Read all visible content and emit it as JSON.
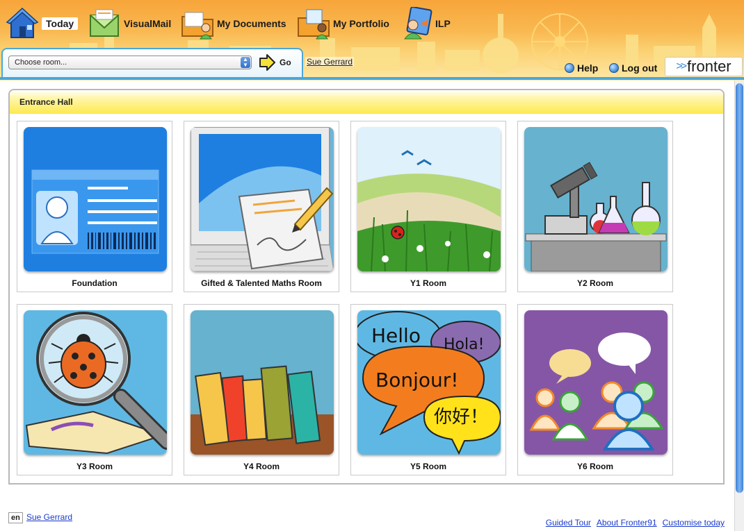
{
  "nav": [
    {
      "label": "Today",
      "icon": "house-icon",
      "active": true
    },
    {
      "label": "VisualMail",
      "icon": "mail-icon"
    },
    {
      "label": "My Documents",
      "icon": "documents-folder-icon"
    },
    {
      "label": "My Portfolio",
      "icon": "portfolio-folder-icon"
    },
    {
      "label": "ILP",
      "icon": "ilp-icon"
    }
  ],
  "room_bar": {
    "select_value": "Choose room...",
    "go_label": "Go",
    "user_name": "Sue Gerrard"
  },
  "utility": {
    "help_label": "Help",
    "logout_label": "Log out",
    "logo_text": "fronter"
  },
  "panel": {
    "title": "Entrance Hall"
  },
  "rooms": [
    {
      "name": "Foundation",
      "icon": "id-card-icon"
    },
    {
      "name": "Gifted & Talented Maths Room",
      "icon": "laptop-notepad-icon"
    },
    {
      "name": "Y1 Room",
      "icon": "meadow-ladybird-icon"
    },
    {
      "name": "Y2 Room",
      "icon": "microscope-flasks-icon"
    },
    {
      "name": "Y3 Room",
      "icon": "magnifier-ladybird-icon"
    },
    {
      "name": "Y4 Room",
      "icon": "books-icon"
    },
    {
      "name": "Y5 Room",
      "icon": "speech-bubbles-languages-icon",
      "bubbles": [
        "Hello",
        "Hola!",
        "Bonjour!",
        "你好！"
      ]
    },
    {
      "name": "Y6 Room",
      "icon": "people-chat-icon"
    }
  ],
  "footer": {
    "lang": "en",
    "user_name": "Sue Gerrard",
    "links": [
      "Guided Tour",
      "About Fronter91",
      "Customise today"
    ]
  },
  "colors": {
    "header_orange": "#f7a53a",
    "accent_blue": "#4aa7d8",
    "panel_yellow": "#fde94e",
    "link_blue": "#1a3acc"
  }
}
